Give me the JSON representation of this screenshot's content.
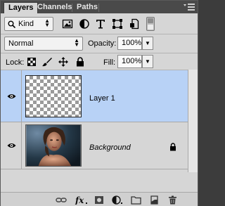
{
  "tabs": [
    {
      "label": "Layers"
    },
    {
      "label": "Channels"
    },
    {
      "label": "Paths"
    }
  ],
  "filter": {
    "kind_label": "Kind",
    "icons": [
      "pixel-filter-icon",
      "adjustment-filter-icon",
      "type-filter-icon",
      "shape-filter-icon",
      "smart-object-filter-icon",
      "filter-toggle-icon"
    ]
  },
  "blend": {
    "mode": "Normal",
    "opacity_label": "Opacity:",
    "opacity_value": "100%"
  },
  "lock": {
    "label": "Lock:",
    "icons": [
      "lock-transparent-pixels-icon",
      "lock-image-pixels-icon",
      "lock-position-icon",
      "lock-all-icon"
    ],
    "fill_label": "Fill:",
    "fill_value": "100%"
  },
  "layers": [
    {
      "name": "Layer 1",
      "selected": true,
      "visible": true
    },
    {
      "name": "Background",
      "selected": false,
      "visible": true,
      "locked": true
    }
  ],
  "bottom_icons": [
    "link-layers-icon",
    "fx-icon",
    "add-mask-icon",
    "adjustment-layer-icon",
    "new-group-icon",
    "new-layer-icon",
    "delete-layer-icon"
  ],
  "colors": {
    "selection": "#b8d2f6",
    "panel": "#d6d6d6",
    "tabbar": "#4a4a4a"
  }
}
